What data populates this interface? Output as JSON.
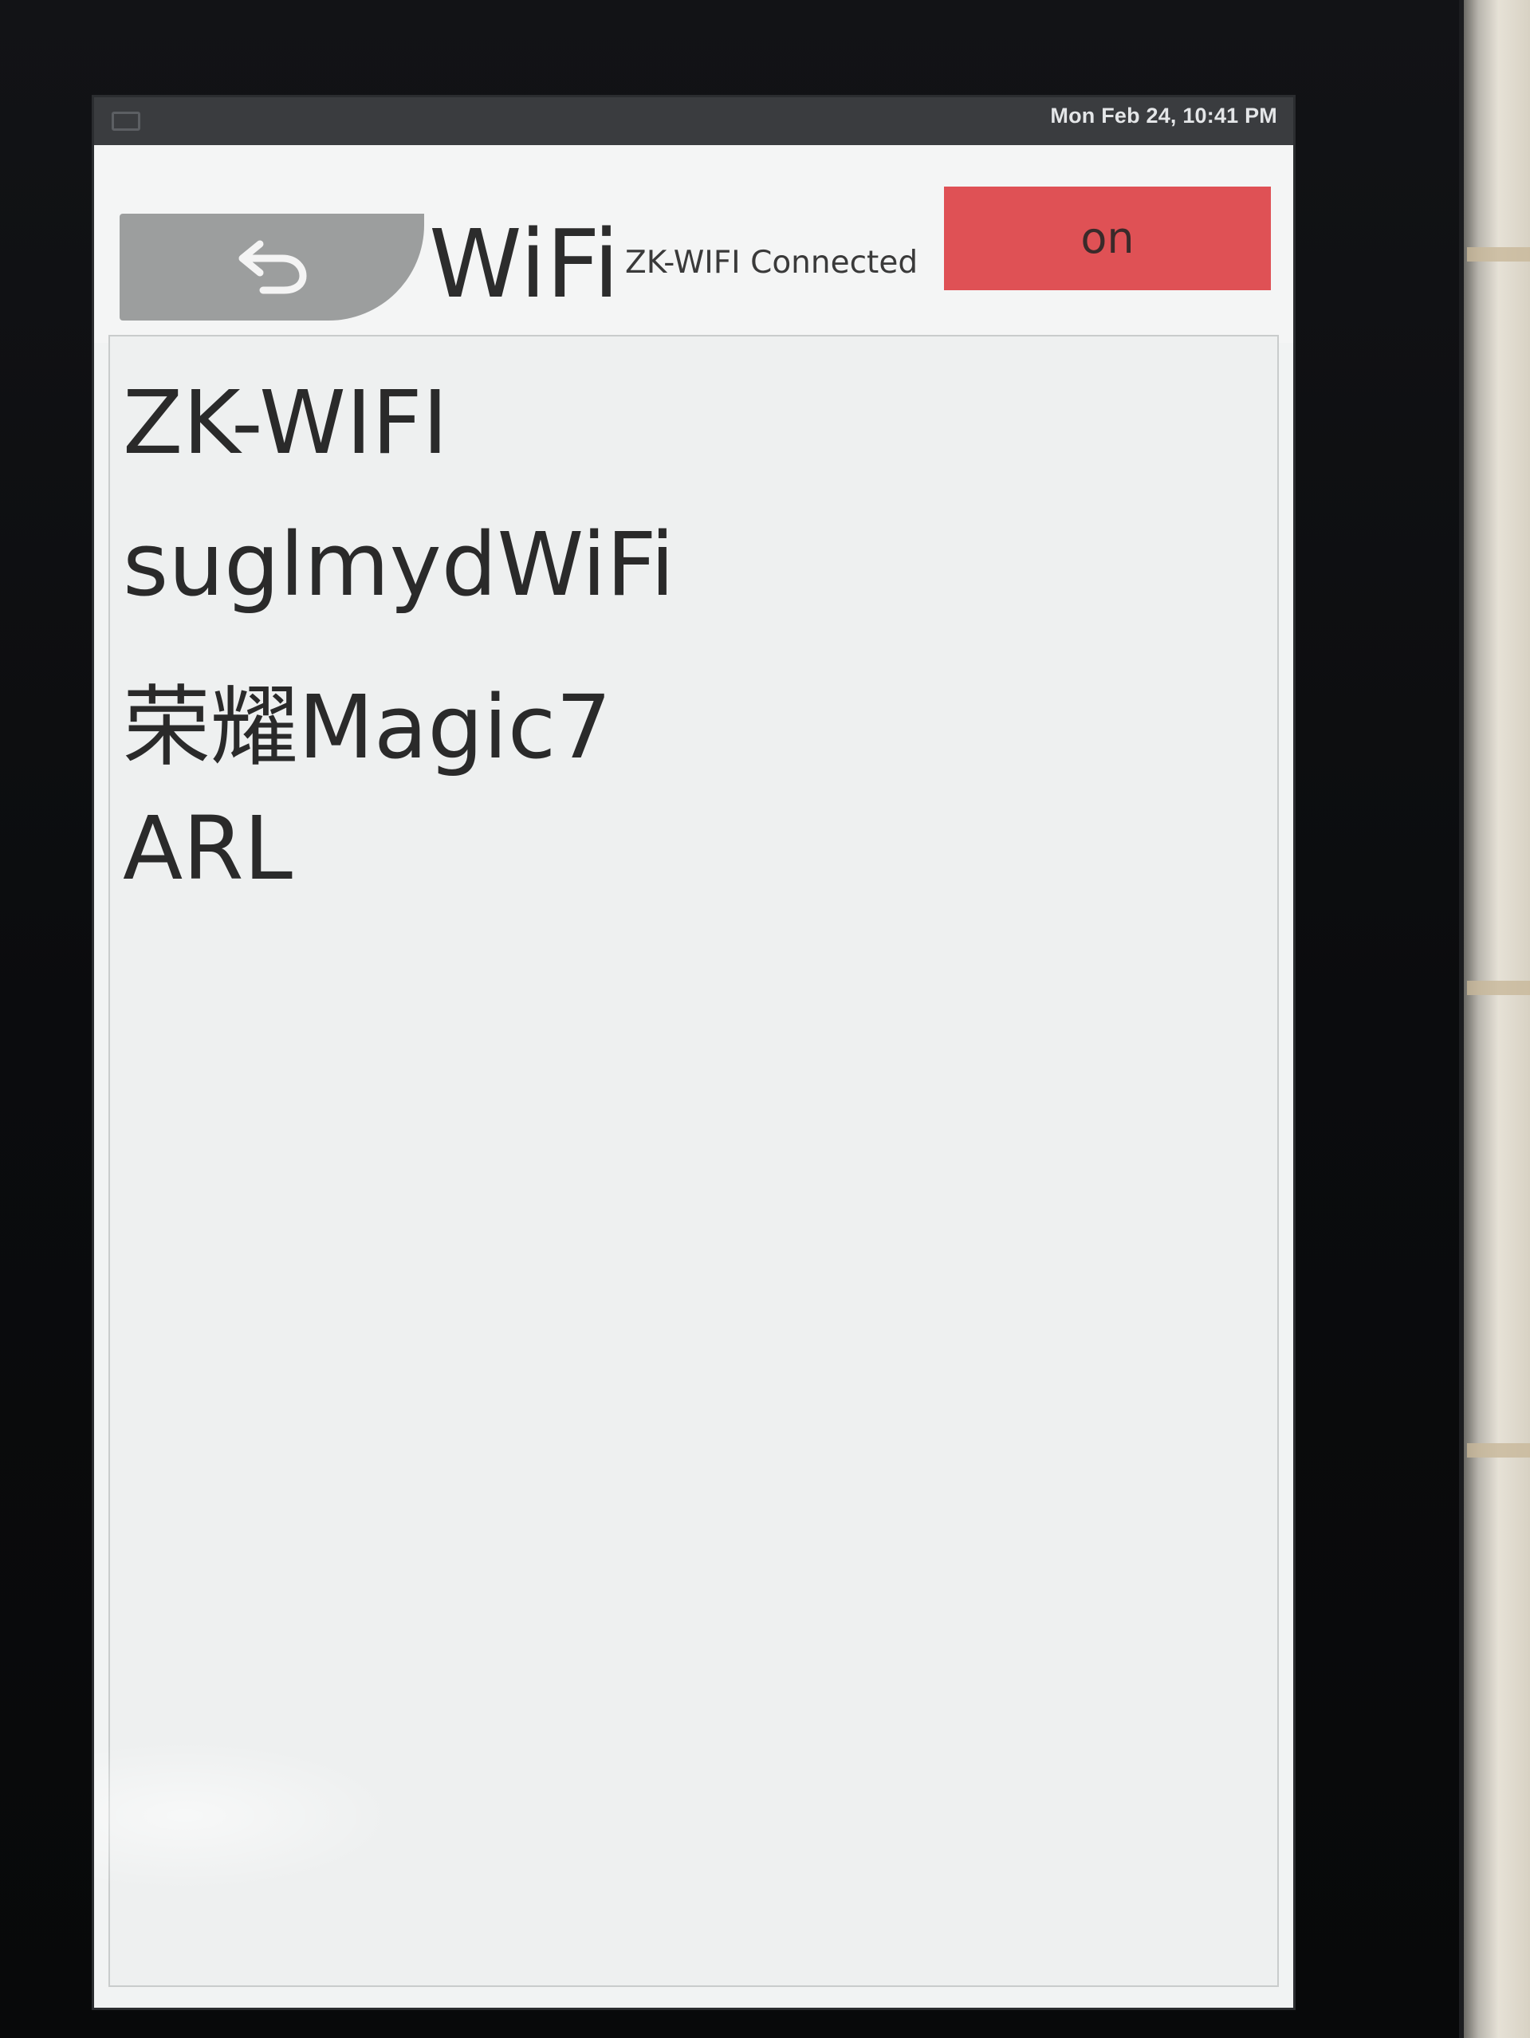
{
  "statusbar": {
    "datetime": "Mon Feb 24, 10:41 PM",
    "icon": "screen-icon"
  },
  "header": {
    "back_icon": "undo-arrow-icon",
    "title": "WiFi",
    "connection_status": "ZK-WIFI Connected",
    "toggle_label": "on",
    "toggle_color": "#df5155"
  },
  "networks": [
    {
      "ssid": "ZK-WIFI"
    },
    {
      "ssid": "suglmydWiFi"
    },
    {
      "ssid": "荣耀Magic7"
    },
    {
      "ssid": "ARL"
    }
  ]
}
